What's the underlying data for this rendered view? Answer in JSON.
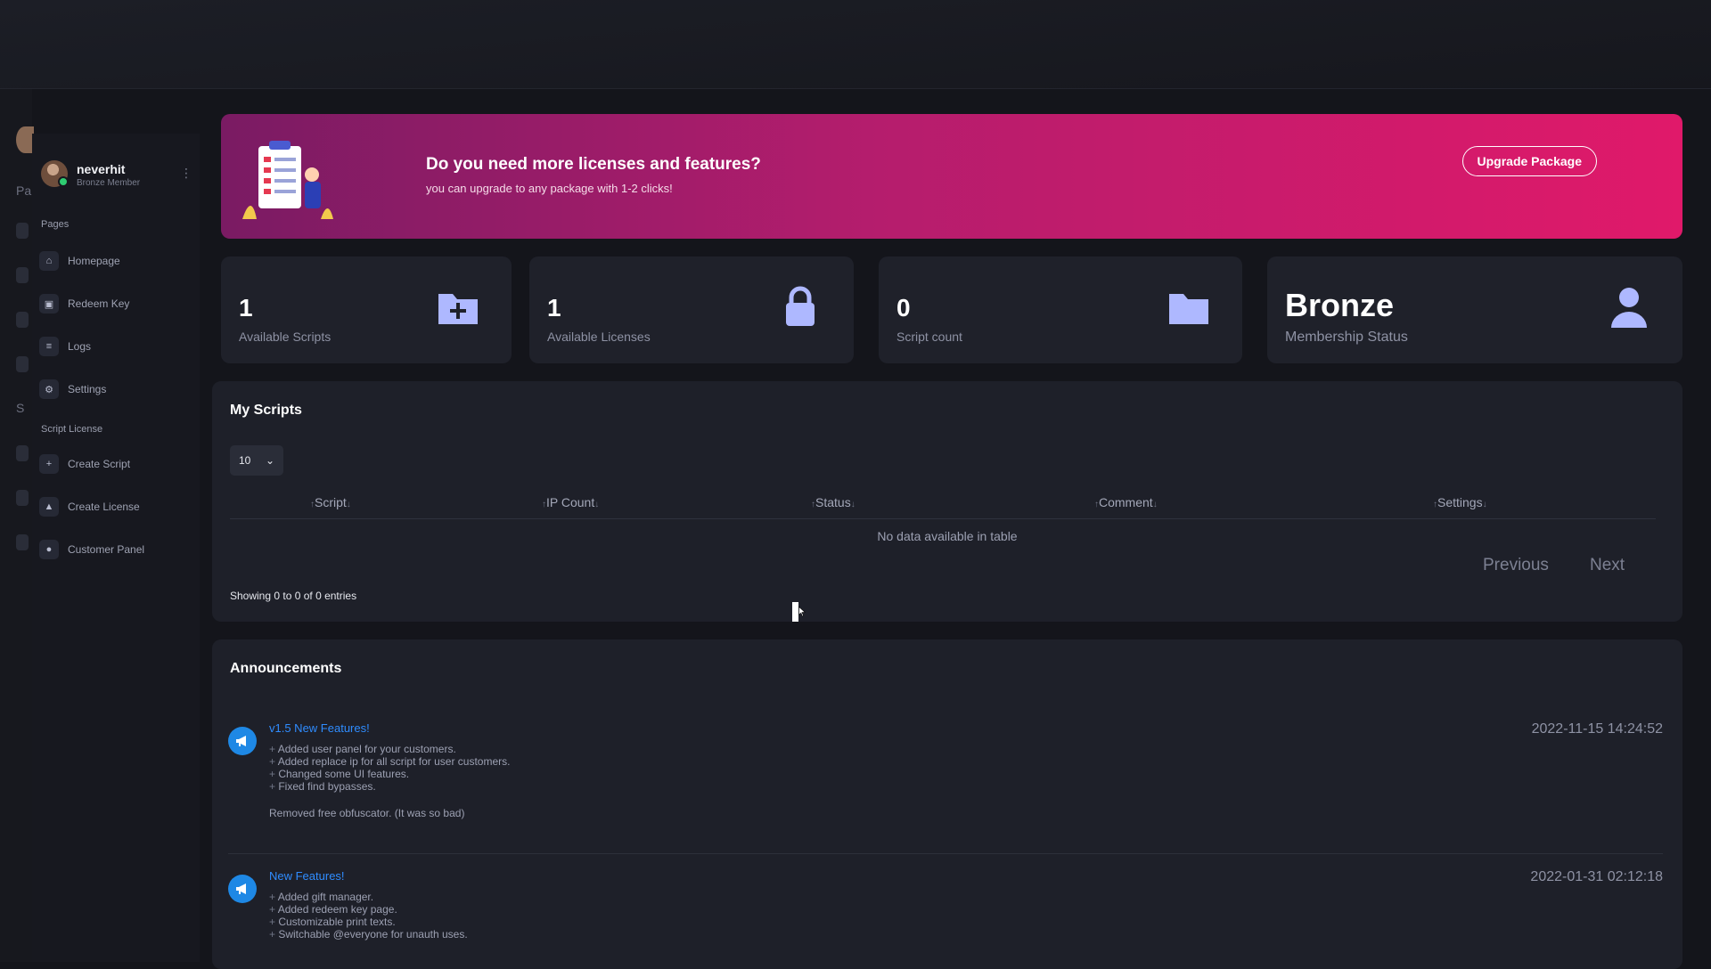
{
  "rail": {
    "labels": [
      "Pa",
      "S"
    ]
  },
  "user": {
    "name": "neverhit",
    "role": "Bronze Member"
  },
  "sidebar": {
    "pages_label": "Pages",
    "pages": [
      {
        "label": "Homepage",
        "icon": "home-icon"
      },
      {
        "label": "Redeem Key",
        "icon": "gift-icon"
      },
      {
        "label": "Logs",
        "icon": "file-icon"
      },
      {
        "label": "Settings",
        "icon": "gear-icon"
      }
    ],
    "license_label": "Script License",
    "license": [
      {
        "label": "Create Script",
        "icon": "plus-square-icon"
      },
      {
        "label": "Create License",
        "icon": "lock-icon"
      },
      {
        "label": "Customer Panel",
        "icon": "user-icon"
      }
    ]
  },
  "banner": {
    "title": "Do you need more licenses and features?",
    "subtitle": "you can upgrade to any package with 1-2 clicks!",
    "button": "Upgrade Package"
  },
  "stats": [
    {
      "value": "1",
      "label": "Available Scripts",
      "icon": "plus-folder-icon"
    },
    {
      "value": "1",
      "label": "Available Licenses",
      "icon": "lock-icon"
    },
    {
      "value": "0",
      "label": "Script count",
      "icon": "folder-icon"
    },
    {
      "value": "Bronze",
      "label": "Membership Status",
      "icon": "user-icon"
    }
  ],
  "scripts": {
    "title": "My Scripts",
    "page_length": "10",
    "columns": [
      "Script",
      "IP Count",
      "Status",
      "Comment",
      "Settings"
    ],
    "empty": "No data available in table",
    "previous": "Previous",
    "next": "Next",
    "showing": "Showing 0 to 0 of 0 entries"
  },
  "announcements": {
    "title": "Announcements",
    "items": [
      {
        "title": "v1.5 New Features!",
        "date": "2022-11-15 14:24:52",
        "lines": [
          "Added user panel for your customers.",
          "Added replace ip for all script for user customers.",
          "Changed some UI features.",
          "Fixed find bypasses."
        ],
        "note": "Removed free obfuscator. (It was so bad)"
      },
      {
        "title": "New Features!",
        "date": "2022-01-31 02:12:18",
        "lines": [
          "Added gift manager.",
          "Added redeem key page.",
          "Customizable print texts.",
          "Switchable @everyone for unauth uses."
        ],
        "note": ""
      }
    ]
  },
  "colors": {
    "accent_blue": "#2f8cff",
    "banner_start": "#7a1b63",
    "banner_end": "#e0196a",
    "icon_blue": "#aeb8ff"
  }
}
